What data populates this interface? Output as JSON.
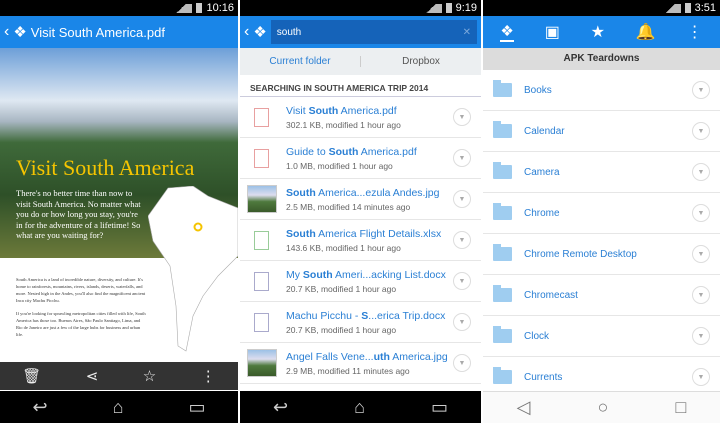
{
  "panel1": {
    "time": "10:16",
    "title": "Visit South America.pdf",
    "doc_title": "Visit South America",
    "doc_intro": "There's no better time than now to visit South America. No matter what you do or how long you stay, you're in for the adventure of a lifetime! So what are you waiting for?",
    "doc_para1": "South America is a land of incredible nature, diversity, and culture. It's home to rainforests, mountains, rivers, islands, deserts, waterfalls, and more. Nested high in the Andes, you'll also find the magnificent ancient Inca city Machu Picchu.",
    "doc_para2": "If you're looking for sprawling metropolitan cities filled with life, South America has those too. Buenos Aires, São Paulo Santiago, Lima, and Rio de Janeiro are just a few of the large hubs for business and urban life."
  },
  "panel2": {
    "time": "9:19",
    "search_value": "south",
    "tabs": [
      "Current folder",
      "Dropbox"
    ],
    "section": "SEARCHING IN SOUTH AMERICA TRIP 2014",
    "files": [
      {
        "pre": "Visit ",
        "bold": "South",
        "post": " America.pdf",
        "meta": "302.1 KB, modified 1 hour ago",
        "type": "pdf"
      },
      {
        "pre": "Guide to ",
        "bold": "South",
        "post": " America.pdf",
        "meta": "1.0 MB, modified 1 hour ago",
        "type": "pdf"
      },
      {
        "pre": "",
        "bold": "South",
        "post": " America...ezula Andes.jpg",
        "meta": "2.5 MB, modified 14 minutes ago",
        "type": "jpg"
      },
      {
        "pre": "",
        "bold": "South",
        "post": " America Flight Details.xlsx",
        "meta": "143.6 KB, modified 1 hour ago",
        "type": "xlsx"
      },
      {
        "pre": "My ",
        "bold": "South",
        "post": " Ameri...acking List.docx",
        "meta": "20.7 KB, modified 1 hour ago",
        "type": "docx"
      },
      {
        "pre": "Machu Picchu - ",
        "bold": "S",
        "post": "...erica Trip.docx",
        "meta": "20.7 KB, modified 1 hour ago",
        "type": "docx"
      },
      {
        "pre": "Angel Falls Vene...",
        "bold": "uth",
        "post": " America.jpg",
        "meta": "2.9 MB, modified 11 minutes ago",
        "type": "jpg"
      }
    ]
  },
  "panel3": {
    "time": "3:51",
    "header": "APK Teardowns",
    "folders": [
      "Books",
      "Calendar",
      "Camera",
      "Chrome",
      "Chrome Remote Desktop",
      "Chromecast",
      "Clock",
      "Currents"
    ]
  }
}
